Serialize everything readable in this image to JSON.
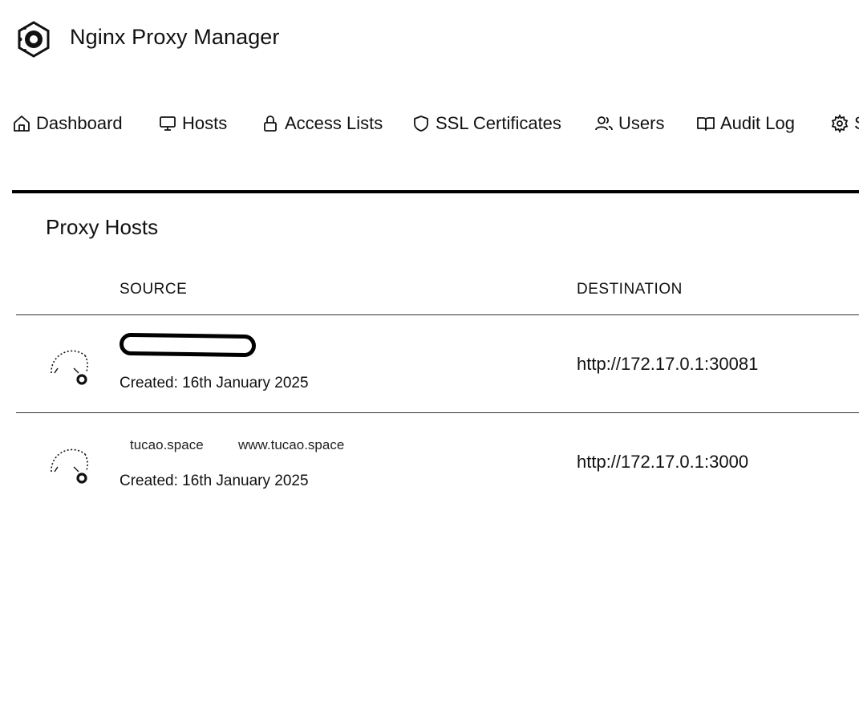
{
  "app": {
    "title": "Nginx Proxy Manager",
    "logo_icon": "nginx-proxy-manager-logo"
  },
  "nav": {
    "items": [
      {
        "label": "Dashboard",
        "icon": "home-icon"
      },
      {
        "label": "Hosts",
        "icon": "monitor-icon"
      },
      {
        "label": "Access Lists",
        "icon": "lock-icon"
      },
      {
        "label": "SSL Certificates",
        "icon": "shield-icon"
      },
      {
        "label": "Users",
        "icon": "users-icon"
      },
      {
        "label": "Audit Log",
        "icon": "book-icon"
      },
      {
        "label": "S",
        "icon": "gear-icon"
      }
    ]
  },
  "card": {
    "title": "Proxy Hosts",
    "columns": {
      "source": "SOURCE",
      "destination": "DESTINATION"
    },
    "rows": [
      {
        "domains": [],
        "source_redacted": true,
        "created": "Created: 16th January 2025",
        "destination": "http://172.17.0.1:30081"
      },
      {
        "domains": [
          "tucao.space",
          "www.tucao.space"
        ],
        "source_redacted": false,
        "created": "Created: 16th January 2025",
        "destination": "http://172.17.0.1:3000"
      }
    ]
  }
}
